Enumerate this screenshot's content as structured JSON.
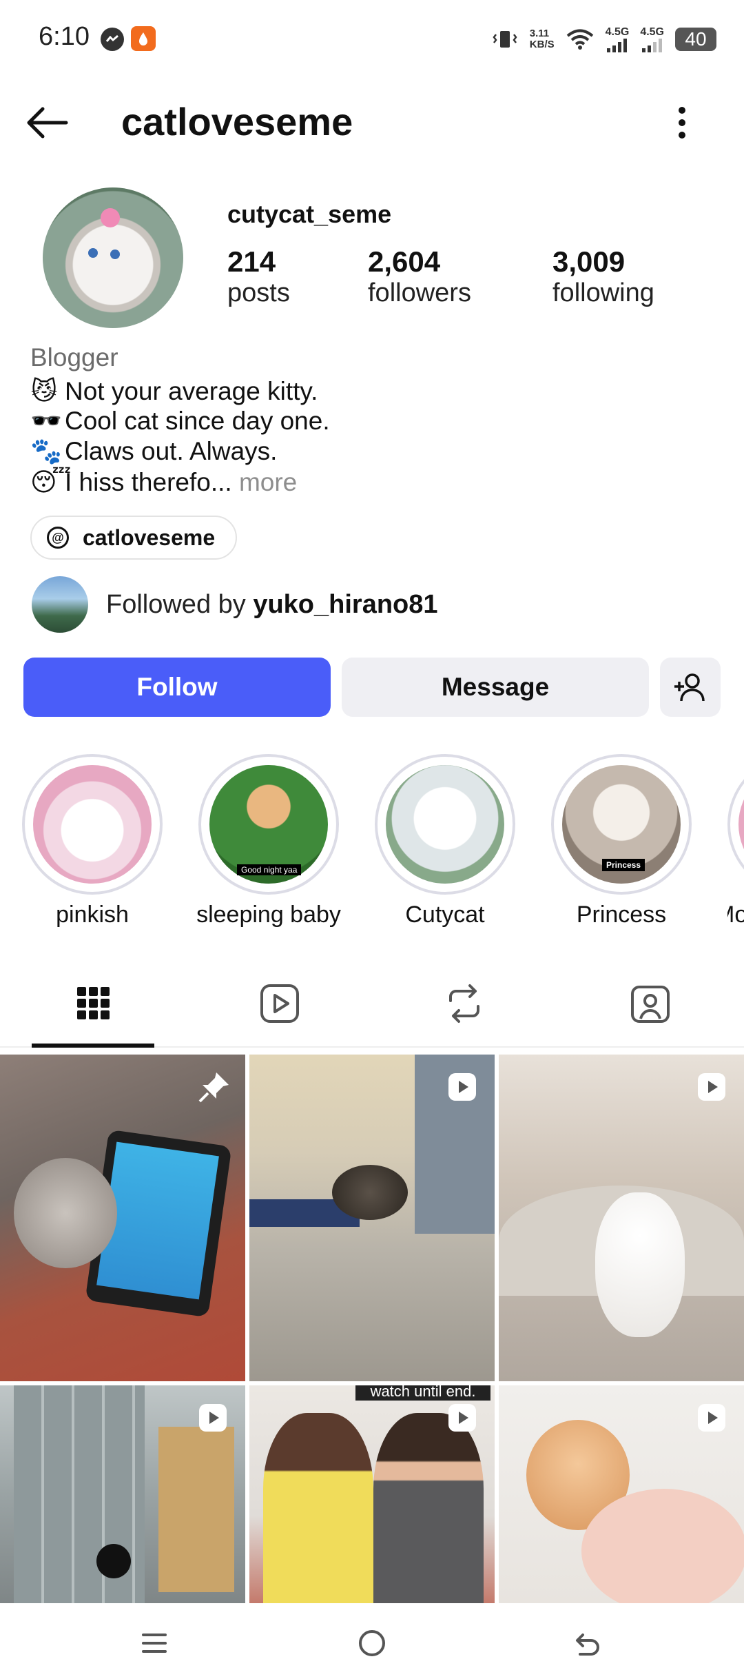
{
  "status": {
    "time": "6:10",
    "net_speed": "3.11",
    "net_unit": "KB/S",
    "sig1": "4.5G",
    "sig2": "4.5G",
    "battery": "40"
  },
  "header": {
    "username": "catloveseme"
  },
  "profile": {
    "display_name": "cutycat_seme",
    "stats": [
      {
        "value": "214",
        "label": "posts"
      },
      {
        "value": "2,604",
        "label": "followers"
      },
      {
        "value": "3,009",
        "label": "following"
      }
    ],
    "category": "Blogger",
    "bio": [
      {
        "emoji": "😼",
        "text": "Not your average kitty."
      },
      {
        "emoji": "🕶️",
        "text": "Cool cat since day one."
      },
      {
        "emoji": "🐾",
        "text": "Claws out. Always."
      },
      {
        "emoji": "😴",
        "text": "I hiss therefo...",
        "more": "more"
      }
    ],
    "threads_handle": "catloveseme",
    "followed_by_prefix": "Followed by",
    "followed_by_user": "yuko_hirano81"
  },
  "buttons": {
    "follow": "Follow",
    "message": "Message"
  },
  "highlights": [
    {
      "label": "pinkish",
      "color": "#e7a8c2"
    },
    {
      "label": "sleeping baby",
      "color": "#3f8a3a",
      "badge": "Good night yaa"
    },
    {
      "label": "Cutycat",
      "color": "#dfe6e8"
    },
    {
      "label": "Princess",
      "color": "#c5b9ae",
      "badge": "Princess"
    },
    {
      "label": "Mo"
    }
  ],
  "tabs": [
    "grid",
    "reels",
    "reposts",
    "tagged"
  ],
  "grid_overlay_text": "watch until end."
}
